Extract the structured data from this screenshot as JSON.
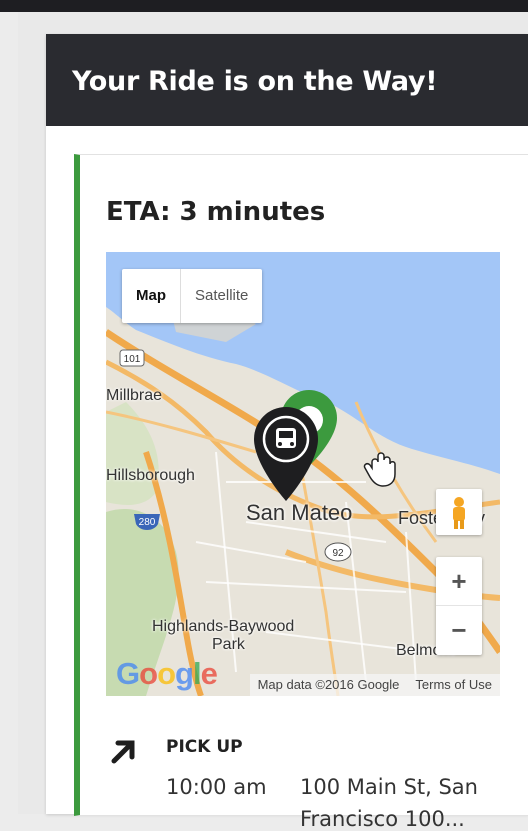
{
  "header": {
    "title": "Your Ride is on the Way!"
  },
  "ride": {
    "eta_text": "ETA: 3 minutes"
  },
  "map": {
    "type_options": [
      "Map",
      "Satellite"
    ],
    "selected_type": "Map",
    "places": [
      "Millbrae",
      "Hillsborough",
      "San Mateo",
      "Foster City",
      "Highlands-Baywood",
      "Park",
      "Belmont"
    ],
    "highways": [
      "101",
      "280",
      "92"
    ],
    "zoom_in_label": "+",
    "zoom_out_label": "−",
    "logo_text": "Google",
    "attribution": "Map data ©2016 Google",
    "terms": "Terms of Use",
    "marker_pickup_icon": "bus-icon",
    "marker_vehicle_color": "#3c9a3e",
    "water_color": "#a3c6f7"
  },
  "pickup": {
    "title": "PICK UP",
    "time": "10:00 am",
    "address_line1": "100 Main St, San",
    "address_line2": "Francisco 100..."
  },
  "colors": {
    "header_bg": "#2a2b30",
    "accent": "#3c9a3e"
  }
}
